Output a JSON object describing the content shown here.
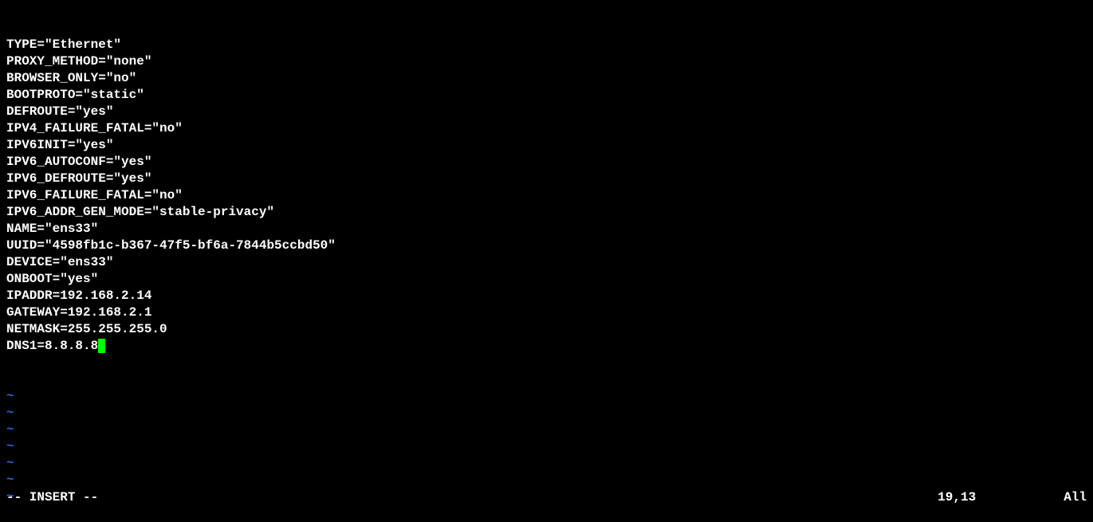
{
  "file_lines": [
    "TYPE=\"Ethernet\"",
    "PROXY_METHOD=\"none\"",
    "BROWSER_ONLY=\"no\"",
    "BOOTPROTO=\"static\"",
    "DEFROUTE=\"yes\"",
    "IPV4_FAILURE_FATAL=\"no\"",
    "IPV6INIT=\"yes\"",
    "IPV6_AUTOCONF=\"yes\"",
    "IPV6_DEFROUTE=\"yes\"",
    "IPV6_FAILURE_FATAL=\"no\"",
    "IPV6_ADDR_GEN_MODE=\"stable-privacy\"",
    "NAME=\"ens33\"",
    "UUID=\"4598fb1c-b367-47f5-bf6a-7844b5ccbd50\"",
    "DEVICE=\"ens33\"",
    "ONBOOT=\"yes\"",
    "IPADDR=192.168.2.14",
    "GATEWAY=192.168.2.1",
    "NETMASK=255.255.255.0",
    "DNS1=8.8.8.8"
  ],
  "tilde_count": 7,
  "tilde_char": "~",
  "status": {
    "mode": "-- INSERT --",
    "position": "19,13",
    "view": "All"
  }
}
